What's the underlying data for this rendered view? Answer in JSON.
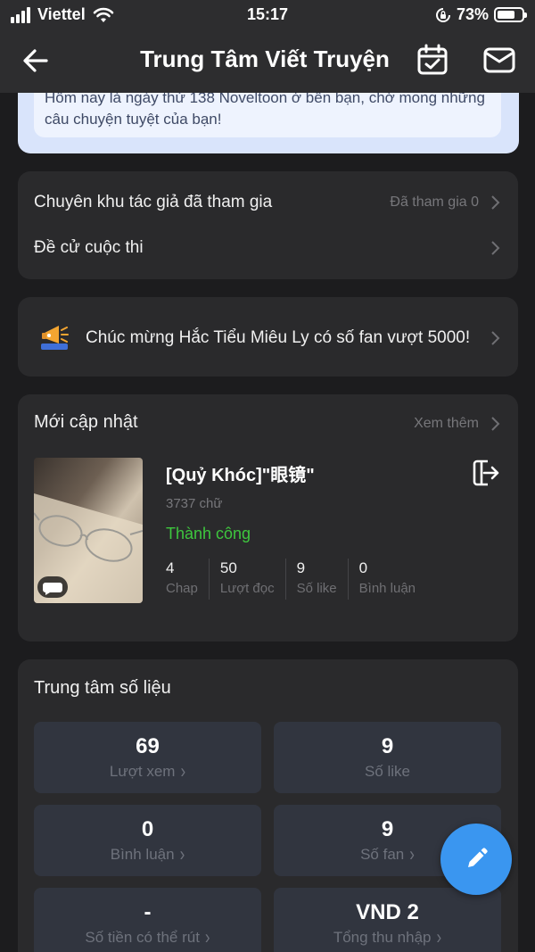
{
  "status_bar": {
    "carrier": "Viettel",
    "time": "15:17",
    "battery": "73%",
    "battery_level": 0.73
  },
  "nav": {
    "title": "Trung Tâm Viết Truyện",
    "back_icon": "arrow-left-icon",
    "calendar_icon": "calendar-check-icon",
    "mail_icon": "mail-icon"
  },
  "notice": {
    "text": "Hôm nay là ngày thứ 138 Noveltoon ở bên bạn, chờ mong những câu chuyện tuyệt của bạn!"
  },
  "links": {
    "author_zone": "Chuyên khu tác giả đã tham gia",
    "author_zone_meta": "Đã tham gia 0",
    "contest": "Đề cử cuộc thi"
  },
  "announcement": {
    "icon": "megaphone-icon",
    "text": "Chúc mừng Hắc Tiểu Miêu Ly có số fan vượt 5000!"
  },
  "updates": {
    "title": "Mới cập nhật",
    "more": "Xem thêm",
    "book": {
      "title": "[Quỷ Khóc]\"眼镜\"",
      "words": "3737 chữ",
      "status": "Thành công",
      "stats": [
        {
          "value": "4",
          "label": "Chap"
        },
        {
          "value": "50",
          "label": "Lượt đọc"
        },
        {
          "value": "9",
          "label": "Số like"
        },
        {
          "value": "0",
          "label": "Bình luận"
        }
      ]
    }
  },
  "data_center": {
    "title": "Trung tâm số liệu",
    "tiles": [
      {
        "value": "69",
        "label": "Lượt xem",
        "arrow": true
      },
      {
        "value": "9",
        "label": "Số like",
        "arrow": false
      },
      {
        "value": "0",
        "label": "Bình luận",
        "arrow": true
      },
      {
        "value": "9",
        "label": "Số fan",
        "arrow": true
      },
      {
        "value": "-",
        "label": "Số tiền có thể rút",
        "arrow": true
      },
      {
        "value": "VND 2",
        "label": "Tổng thu nhập",
        "arrow": true
      }
    ]
  },
  "fab_icon": "pencil-icon",
  "colors": {
    "background": "#1c1c1e",
    "card": "#2a2a2c",
    "tile": "#31353f",
    "success": "#3ec73e",
    "fab": "#3a96f0",
    "notice": "#d9e4fb"
  }
}
